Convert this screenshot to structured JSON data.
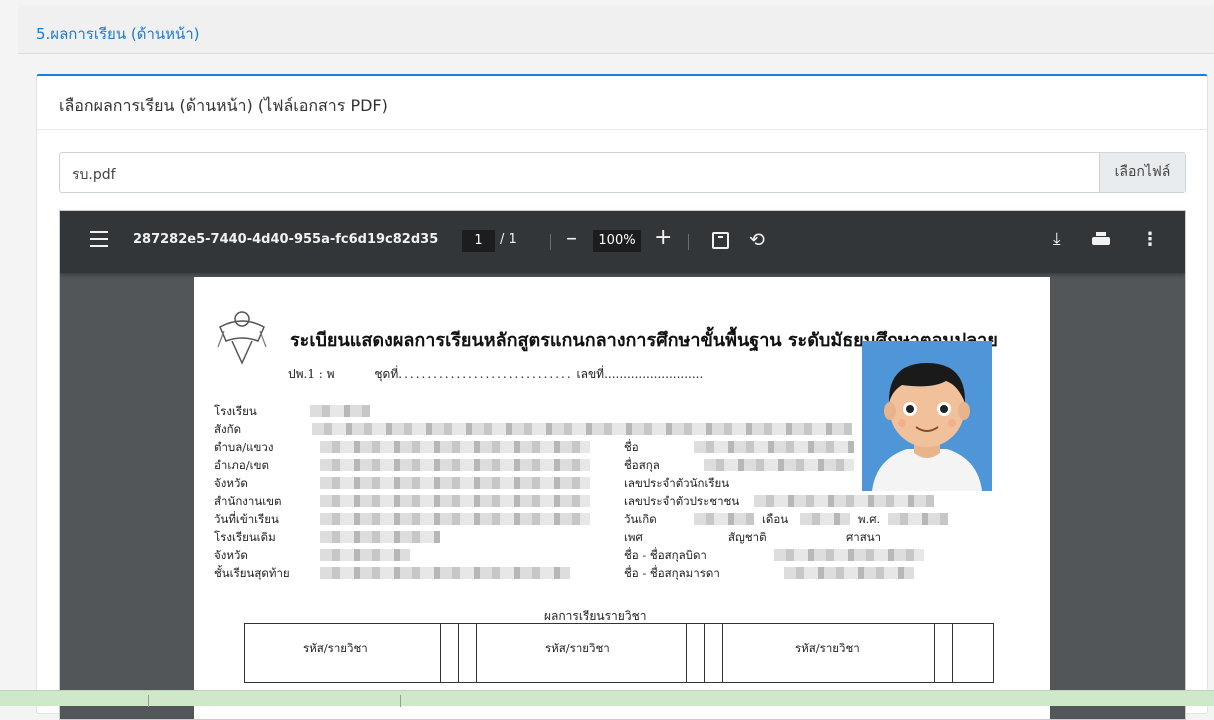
{
  "section": {
    "title": "5.ผลการเรียน (ด้านหน้า)"
  },
  "card": {
    "title": "เลือกผลการเรียน (ด้านหน้า) (ไฟล์เอกสาร PDF)"
  },
  "file_input": {
    "value": "รบ.pdf",
    "button_label": "เลือกไฟล์"
  },
  "pdf_viewer": {
    "filename": "287282e5-7440-4d40-955a-fc6d19c82d35",
    "page_current": "1",
    "page_total": "/ 1",
    "zoom": "100%",
    "icons": [
      "menu-icon",
      "zoom-out-icon",
      "zoom-in-icon",
      "fit-page-icon",
      "rotate-icon",
      "download-icon",
      "print-icon",
      "more-icon"
    ]
  },
  "document": {
    "title": "ระเบียนแสดงผลการเรียนหลักสูตรแกนกลางการศึกษาขั้นพื้นฐาน ระดับมัธยมศึกษาตอนปลาย",
    "form_code": "ปพ.1 : พ",
    "set_label": "ชุดที่",
    "number_label": "เลขที่",
    "left_labels": [
      "โรงเรียน",
      "สังกัด",
      "ตำบล/แขวง",
      "อำเภอ/เขต",
      "จังหวัด",
      "สำนักงานเขต",
      "วันที่เข้าเรียน",
      "โรงเรียนเดิม",
      "จังหวัด",
      "ชั้นเรียนสุดท้าย"
    ],
    "right_labels": [
      "ชื่อ",
      "ชื่อสกุล",
      "เลขประจำตัวนักเรียน",
      "เลขประจำตัวประชาชน",
      "วันเกิด",
      "เพศ",
      "ชื่อ - ชื่อสกุลบิดา",
      "ชื่อ - ชื่อสกุลมารดา"
    ],
    "month_label": "เดือน",
    "year_label": "พ.ศ.",
    "nationality_label": "สัญชาติ",
    "religion_label": "ศาสนา",
    "grades_title": "ผลการเรียนรายวิชา",
    "column_header": "รหัส/รายวิชา"
  }
}
